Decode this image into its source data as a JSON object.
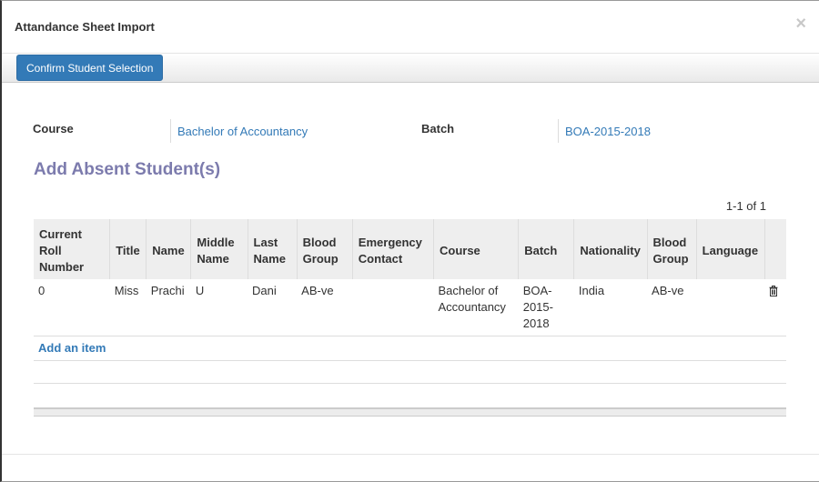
{
  "dialog": {
    "title": "Attandance Sheet Import",
    "close_icon": "×"
  },
  "toolbar": {
    "confirm_label": "Confirm Student Selection"
  },
  "form": {
    "course_label": "Course",
    "course_value": "Bachelor of Accountancy",
    "batch_label": "Batch",
    "batch_value": "BOA-2015-2018"
  },
  "section": {
    "title": "Add Absent Student(s)",
    "pager": "1-1 of 1"
  },
  "table": {
    "headers": {
      "roll": "Current Roll Number",
      "title": "Title",
      "name": "Name",
      "middle": "Middle Name",
      "last": "Last Name",
      "blood1": "Blood Group",
      "emergency": "Emergency Contact",
      "course": "Course",
      "batch": "Batch",
      "nationality": "Nationality",
      "blood2": "Blood Group",
      "language": "Language"
    },
    "rows": [
      {
        "roll": "0",
        "title": "Miss",
        "name": "Prachi",
        "middle": "U",
        "last": "Dani",
        "blood1": "AB-ve",
        "emergency": "",
        "course": "Bachelor of Accountancy",
        "batch": "BOA-2015-2018",
        "nationality": "India",
        "blood2": "AB-ve",
        "language": ""
      }
    ],
    "add_item": "Add an item"
  },
  "icons": {
    "delete": "trash-icon"
  }
}
